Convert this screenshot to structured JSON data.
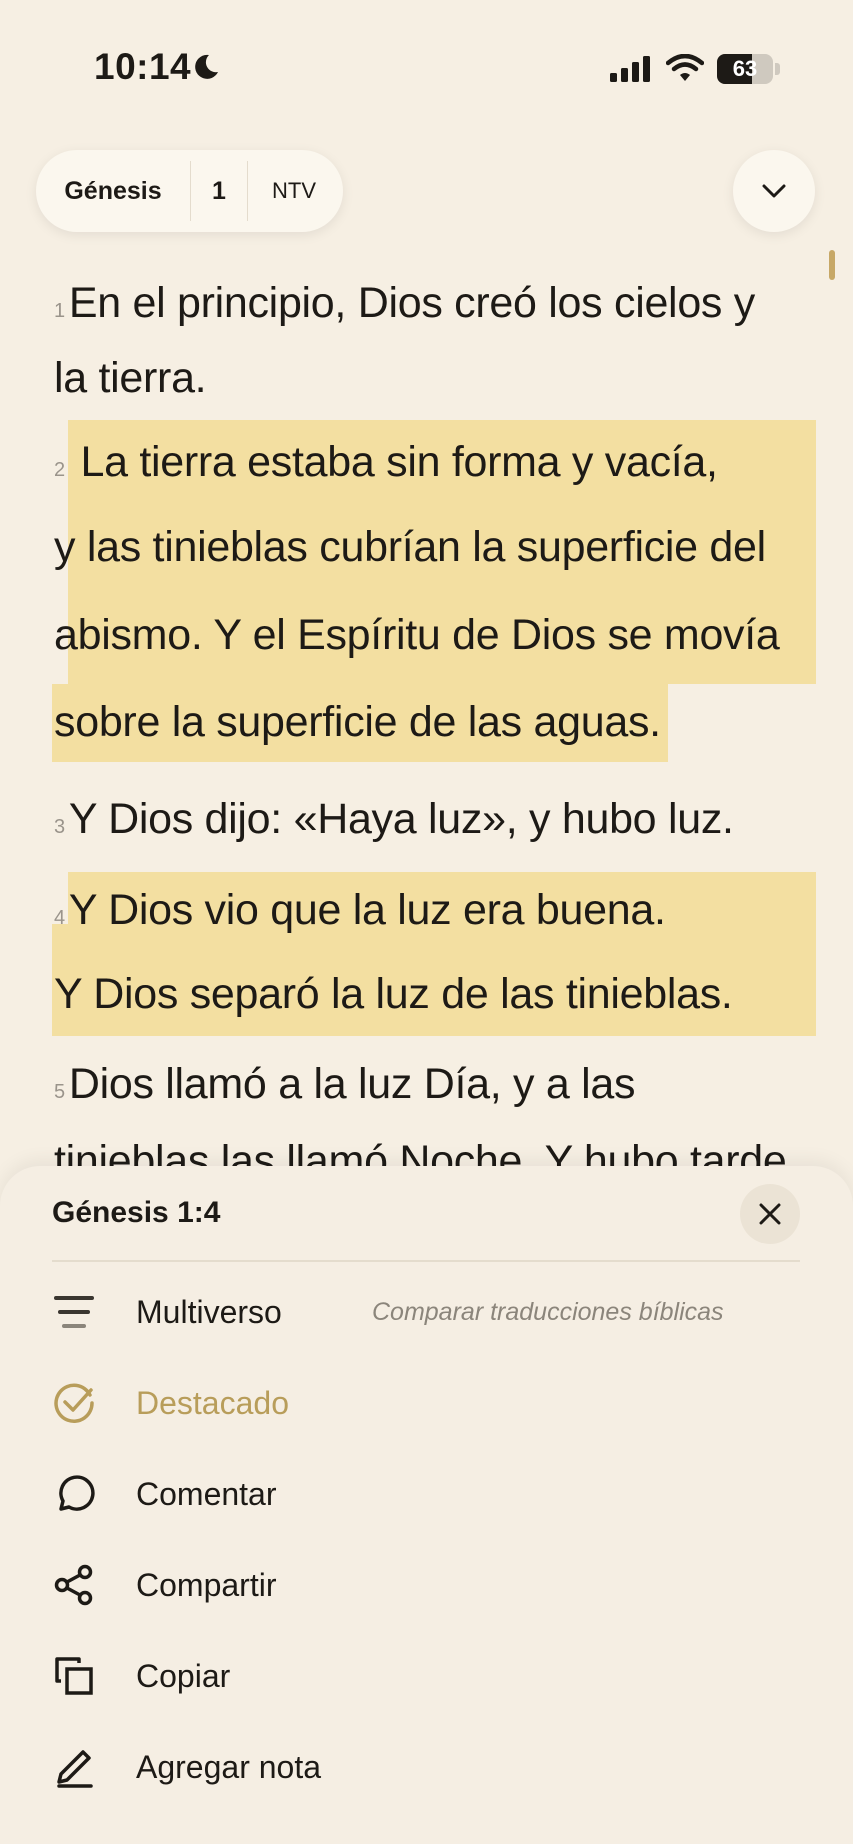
{
  "status": {
    "time": "10:14",
    "battery": "63",
    "battery_level": 0.63
  },
  "nav": {
    "book": "Génesis",
    "chapter": "1",
    "version": "NTV"
  },
  "reading": {
    "lines": [
      {
        "num": "1",
        "text": "En el principio, Dios creó los cielos y"
      },
      {
        "num": "",
        "text": "la tierra."
      },
      {
        "num": "2",
        "text": "La tierra estaba sin forma y vacía,"
      },
      {
        "num": "",
        "text": "y las tinieblas cubrían la superficie del"
      },
      {
        "num": "",
        "text": "abismo. Y el Espíritu de Dios se movía"
      },
      {
        "num": "",
        "text": "sobre la superficie de las aguas."
      },
      {
        "num": "3",
        "text": "Y Dios dijo: «Haya luz», y hubo luz."
      },
      {
        "num": "4",
        "text": "Y Dios vio que la luz era buena."
      },
      {
        "num": "",
        "text": "Y Dios separó la luz de las tinieblas."
      },
      {
        "num": "5",
        "text": "Dios llamó a la luz Día, y a las"
      },
      {
        "num": "",
        "text": "tinieblas las llamó Noche. Y hubo tarde"
      }
    ]
  },
  "sheet": {
    "title": "Génesis 1:4",
    "actions": [
      {
        "label": "Multiverso",
        "desc": "Comparar traducciones bíblicas",
        "icon": "lines-icon"
      },
      {
        "label": "Destacado",
        "desc": "",
        "icon": "check-circle-icon"
      },
      {
        "label": "Comentar",
        "desc": "",
        "icon": "comment-icon"
      },
      {
        "label": "Compartir",
        "desc": "",
        "icon": "share-icon"
      },
      {
        "label": "Copiar",
        "desc": "",
        "icon": "copy-icon"
      },
      {
        "label": "Agregar nota",
        "desc": "",
        "icon": "pencil-icon"
      }
    ]
  },
  "colors": {
    "background": "#f6efe3",
    "highlight": "#f3dfa1",
    "accent": "#b89d5a"
  }
}
